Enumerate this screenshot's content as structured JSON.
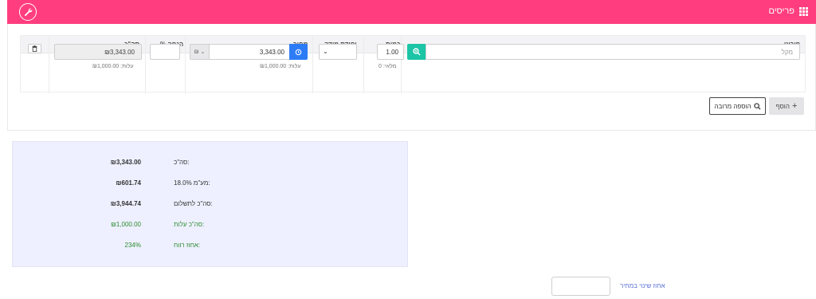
{
  "header": {
    "title": "פריסים",
    "color": "#ff3d7f",
    "icons": [
      "wrench-icon",
      "grid-icon"
    ]
  },
  "table": {
    "columns": {
      "description": "פירוט",
      "quantity": "כמות",
      "unit": "יחידת מידה",
      "price": "מחיר",
      "markup": "% הנחה",
      "total": "סה\"כ"
    },
    "row": {
      "description_placeholder": "מקל",
      "quantity": "1.00",
      "stock_note": "מלאי: 0",
      "unit": "",
      "price_currency": "₪",
      "price": "3,343.00",
      "price_cost_note": "עלות: ₪1,000.00",
      "markup": "",
      "total": "₪3,343.00",
      "total_cost_note": "עלות: ₪1,000.00"
    }
  },
  "actions": {
    "add_label": "הוסף",
    "bulk_add_label": "הוספה מרובה"
  },
  "summary": {
    "rows": [
      {
        "label": "סה\"כ:",
        "value": "₪3,343.00",
        "color": "#333333"
      },
      {
        "label": "מע\"מ 18.0%:",
        "value": "₪601.74",
        "color": "#333333"
      },
      {
        "label": "סה\"כ לתשלום:",
        "value": "₪3,944.74",
        "color": "#333333"
      },
      {
        "label": "סה\"כ עלות:",
        "value": "₪1,000.00",
        "color": "#2e8b2e"
      },
      {
        "label": "אחוז רווח:",
        "value": "234%",
        "color": "#2e8b2e"
      }
    ]
  },
  "price_change": {
    "label": "אחוז שינוי במחיר",
    "value": ""
  }
}
